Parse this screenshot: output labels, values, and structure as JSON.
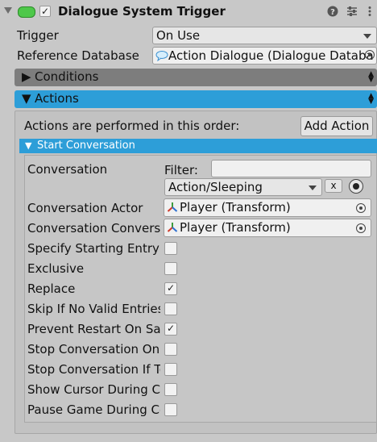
{
  "component": {
    "title": "Dialogue System Trigger",
    "enabled_checked": "✓",
    "icons": [
      "help-icon",
      "preset-icon",
      "more-icon"
    ]
  },
  "fields": {
    "trigger_label": "Trigger",
    "trigger_value": "On Use",
    "database_label": "Reference Database",
    "database_value": "Action Dialogue (Dialogue Databa"
  },
  "sections": {
    "conditions_label": "Conditions",
    "actions_label": "Actions"
  },
  "actions": {
    "order_text": "Actions are performed in this order:",
    "add_action_label": "Add Action",
    "start_conversation_label": "Start Conversation",
    "conversation_label": "Conversation",
    "filter_label": "Filter:",
    "filter_value": "",
    "conversation_value": "Action/Sleeping",
    "clear_label": "x",
    "actor_label": "Conversation Actor",
    "actor_value": "Player (Transform)",
    "conversant_label": "Conversation Conversa",
    "conversant_value": "Player (Transform)",
    "options": [
      {
        "label": "Specify Starting Entry",
        "checked": ""
      },
      {
        "label": "Exclusive",
        "checked": ""
      },
      {
        "label": "Replace",
        "checked": "✓"
      },
      {
        "label": "Skip If No Valid Entries",
        "checked": ""
      },
      {
        "label": "Prevent Restart On San",
        "checked": "✓"
      },
      {
        "label": "Stop Conversation On T",
        "checked": ""
      },
      {
        "label": "Stop Conversation If To",
        "checked": ""
      },
      {
        "label": "Show Cursor During Co",
        "checked": ""
      },
      {
        "label": "Pause Game During Co",
        "checked": ""
      }
    ]
  },
  "colors": {
    "actions_bar": "#2d9ed8",
    "conditions_bar": "#7d7d7d",
    "enabled_pill": "#4ec84a"
  }
}
